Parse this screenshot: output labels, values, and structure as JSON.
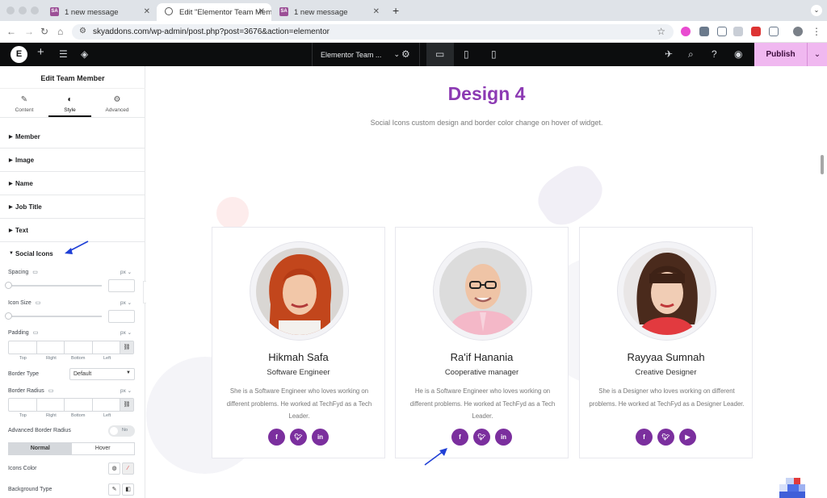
{
  "browser": {
    "tabs": [
      {
        "label": "1 new message",
        "favicon": "SA"
      },
      {
        "label": "Edit \"Elementor Team Memb",
        "favicon": "globe"
      },
      {
        "label": "1 new message",
        "favicon": "SA"
      }
    ],
    "new_tab": "+",
    "url": "skyaddons.com/wp-admin/post.php?post=3676&action=elementor"
  },
  "editor": {
    "logo": "E",
    "document_title": "Elementor Team ...",
    "publish_label": "Publish"
  },
  "panel": {
    "title": "Edit Team Member",
    "tabs": [
      {
        "label": "Content",
        "icon": "pencil-icon"
      },
      {
        "label": "Style",
        "icon": "half-circle-icon"
      },
      {
        "label": "Advanced",
        "icon": "gear-icon"
      }
    ],
    "sections": [
      "Member",
      "Image",
      "Name",
      "Job Title",
      "Text",
      "Social Icons"
    ],
    "controls": {
      "spacing": "Spacing",
      "icon_size": "Icon Size",
      "padding": "Padding",
      "border_type": "Border Type",
      "border_type_value": "Default",
      "border_radius": "Border Radius",
      "advanced_border_radius": "Advanced Border Radius",
      "advanced_toggle": "No",
      "unit": "px",
      "dim_top": "Top",
      "dim_right": "Right",
      "dim_bottom": "Bottom",
      "dim_left": "Left",
      "normal": "Normal",
      "hover": "Hover",
      "icons_color": "Icons Color",
      "background_type": "Background Type"
    }
  },
  "canvas": {
    "title": "Design 4",
    "subtitle": "Social Icons custom design and border color change on hover of widget.",
    "members": [
      {
        "name": "Hikmah Safa",
        "role": "Software Engineer",
        "desc": "She is a Software Engineer who loves working on different problems. He worked at TechFyd as a Tech Leader.",
        "socials": [
          "f",
          "t",
          "in"
        ]
      },
      {
        "name": "Ra'if Hanania",
        "role": "Cooperative manager",
        "desc": "He is a Software Engineer who loves working on different problems. He worked at TechFyd as a Tech Leader.",
        "socials": [
          "f",
          "t",
          "in"
        ]
      },
      {
        "name": "Rayyaa Sumnah",
        "role": "Creative Designer",
        "desc": "She is a Designer who loves working on different problems. He worked at TechFyd as a Designer Leader.",
        "socials": [
          "f",
          "t",
          "yt"
        ]
      }
    ]
  },
  "colors": {
    "accent": "#8c3ab3",
    "social": "#7b2f9e",
    "publish": "#f0b8f0",
    "annotation_arrow": "#1f3fd6"
  }
}
